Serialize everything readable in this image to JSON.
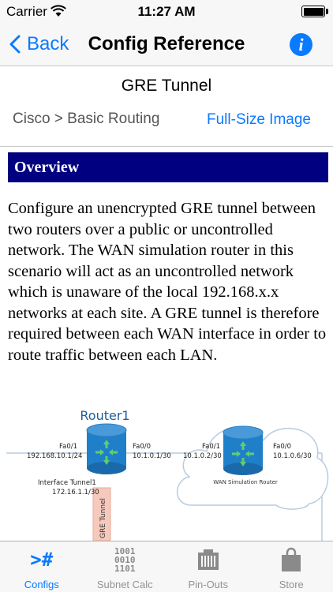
{
  "status_bar": {
    "carrier": "Carrier",
    "time": "11:27 AM",
    "battery_level": 1.0
  },
  "nav": {
    "back_label": "Back",
    "title": "Config Reference",
    "info_label": "i"
  },
  "page": {
    "subject": "GRE Tunnel",
    "breadcrumb": "Cisco > Basic Routing",
    "fullsize_link": "Full-Size Image"
  },
  "overview": {
    "heading": "Overview",
    "text": "Configure an unencrypted GRE tunnel between two routers over a public or uncontrolled network. The WAN simulation router in this scenario will act as an uncontrolled network which is unaware of the local 192.168.x.x networks at each site. A GRE tunnel is therefore required between each WAN interface in order to route traffic between each LAN."
  },
  "diagram": {
    "router1_name": "Router1",
    "r1_fa01_label": "Fa0/1",
    "r1_fa01_ip": "192.168.10.1/24",
    "r1_fa00_label": "Fa0/0",
    "r1_fa00_ip": "10.1.0.1/30",
    "tunnel_label": "Interface Tunnel1",
    "tunnel_ip": "172.16.1.1/30",
    "tunnel_vertical": "GRE Tunnel",
    "wan_fa01_label": "Fa0/1",
    "wan_fa01_ip": "10.1.0.2/30",
    "wan_fa00_label": "Fa0/0",
    "wan_fa00_ip": "10.1.0.6/30",
    "wan_router_name": "WAN Simulation Router"
  },
  "tabs": [
    {
      "label": "Configs",
      "icon": "configs-icon",
      "glyph": ">#",
      "active": true
    },
    {
      "label": "Subnet Calc",
      "icon": "binary-icon",
      "glyph_lines": [
        "1001",
        "0010",
        "1101"
      ],
      "active": false
    },
    {
      "label": "Pin-Outs",
      "icon": "connector-icon",
      "active": false
    },
    {
      "label": "Store",
      "icon": "shopping-bag-icon",
      "active": false
    }
  ],
  "colors": {
    "accent": "#0a7aff",
    "section_header": "#000080",
    "router_blue": "#1f7fc9",
    "router_green": "#5fcf6c",
    "tunnel_pink": "#f7c9bc"
  }
}
